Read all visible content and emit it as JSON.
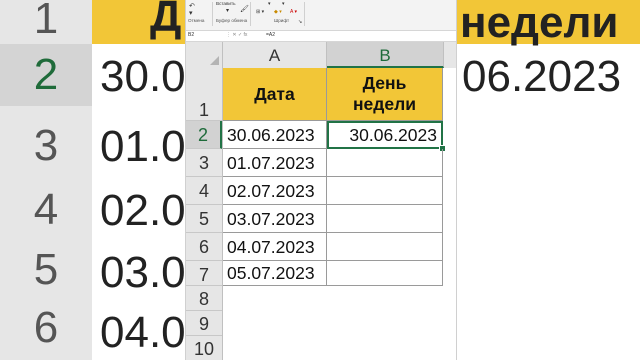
{
  "background": {
    "row_numbers": [
      "1",
      "2",
      "3",
      "4",
      "5",
      "6"
    ],
    "header_partial": "Д",
    "header_partial_right": "недели",
    "row2_left": "30.06.2023",
    "row2_right": "06.2023",
    "row3_left": "01.0",
    "row4_left": "02.0",
    "row5_left": "03.0",
    "row6_left": "04.0"
  },
  "ribbon": {
    "paste_label": "Вставить",
    "undo_group": "Отмена",
    "clipboard_group": "Буфер обмена",
    "font_group": "Шрифт"
  },
  "formula_bar": {
    "name_box": "B2",
    "formula": "=A2",
    "icons": "⋮  ✕  ✓  fx"
  },
  "columns": [
    "A",
    "B"
  ],
  "rows": [
    "1",
    "2",
    "3",
    "4",
    "5",
    "6",
    "7",
    "8",
    "9",
    "10"
  ],
  "table": {
    "header_a": "Дата",
    "header_b_line1": "День",
    "header_b_line2": "недели",
    "dates": [
      "30.06.2023",
      "01.07.2023",
      "02.07.2023",
      "03.07.2023",
      "04.07.2023",
      "05.07.2023"
    ],
    "b2_value": "30.06.2023"
  },
  "colors": {
    "header_fill": "#f2c637",
    "selection": "#217346"
  }
}
